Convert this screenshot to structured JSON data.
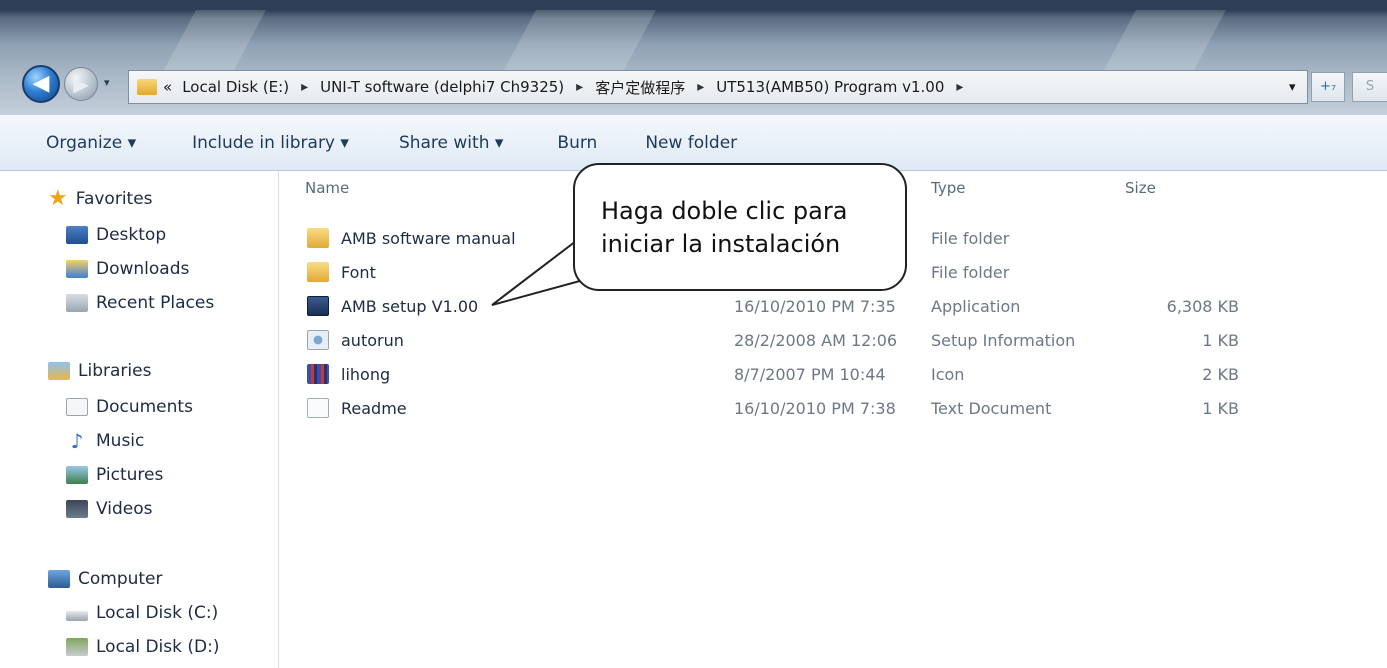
{
  "address": {
    "crumbs": [
      "Local Disk (E:)",
      "UNI-T software (delphi7 Ch9325)",
      "客户定做程序",
      "UT513(AMB50) Program v1.00"
    ],
    "overflow_glyph": "«",
    "chevron": "▸",
    "dropdown_glyph": "▾",
    "refresh_glyph": "+₇",
    "search_glyph": "S"
  },
  "nav": {
    "back_glyph": "◀",
    "forward_glyph": "▶",
    "recent_glyph": "▾"
  },
  "toolbar": {
    "organize": "Organize ▾",
    "include_in_library": "Include in library ▾",
    "share_with": "Share with ▾",
    "burn": "Burn",
    "new_folder": "New folder"
  },
  "sidebar": {
    "favorites": {
      "label": "Favorites",
      "items": [
        "Desktop",
        "Downloads",
        "Recent Places"
      ]
    },
    "libraries": {
      "label": "Libraries",
      "items": [
        "Documents",
        "Music",
        "Pictures",
        "Videos"
      ]
    },
    "computer": {
      "label": "Computer",
      "items": [
        "Local Disk (C:)",
        "Local Disk (D:)"
      ]
    }
  },
  "columns": {
    "name": "Name",
    "type": "Type",
    "size": "Size"
  },
  "files": [
    {
      "name": "AMB software manual",
      "date": "",
      "type": "File folder",
      "size": "",
      "icon": "folder-icon"
    },
    {
      "name": "Font",
      "date": "",
      "type": "File folder",
      "size": "",
      "icon": "folder-icon"
    },
    {
      "name": "AMB setup V1.00",
      "date": "16/10/2010 PM 7:35",
      "type": "Application",
      "size": "6,308 KB",
      "icon": "application-icon"
    },
    {
      "name": "autorun",
      "date": "28/2/2008 AM 12:06",
      "type": "Setup Information",
      "size": "1 KB",
      "icon": "setup-info-icon"
    },
    {
      "name": "lihong",
      "date": "8/7/2007 PM 10:44",
      "type": "Icon",
      "size": "2 KB",
      "icon": "icon-file-icon"
    },
    {
      "name": "Readme",
      "date": "16/10/2010 PM 7:38",
      "type": "Text Document",
      "size": "1 KB",
      "icon": "text-document-icon"
    }
  ],
  "callout": {
    "line1": "Haga doble clic para",
    "line2": "iniciar la instalación"
  },
  "colors": {
    "folder": "#e8b84a",
    "link_text": "#1e3a5c",
    "meta_text": "#6d7886",
    "titlebar": "#8fa1b4"
  }
}
